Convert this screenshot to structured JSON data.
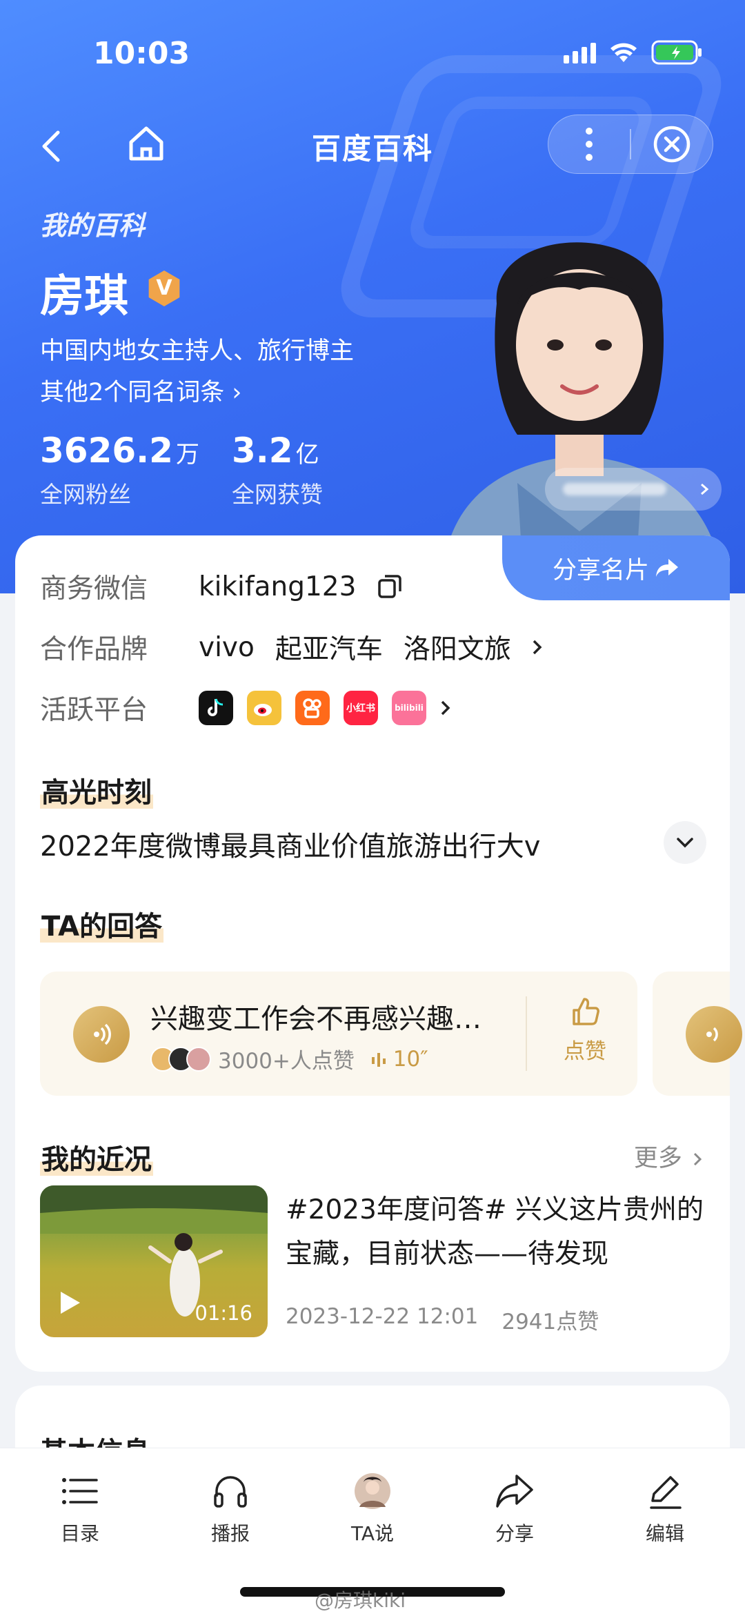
{
  "status_bar": {
    "time": "10:03"
  },
  "nav": {
    "title": "百度百科"
  },
  "hero": {
    "section_label": "我的百科",
    "name": "房琪",
    "badge": "V",
    "description": "中国内地女主持人、旅行博主",
    "same_name_link": "其他2个同名词条 ›",
    "stats": [
      {
        "value": "3626.2",
        "unit": "万",
        "label": "全网粉丝"
      },
      {
        "value": "3.2",
        "unit": "亿",
        "label": "全网获赞"
      }
    ]
  },
  "card": {
    "share_label": "分享名片",
    "rows": {
      "wechat": {
        "key": "商务微信",
        "value": "kikifang123"
      },
      "brands": {
        "key": "合作品牌",
        "values": [
          "vivo",
          "起亚汽车",
          "洛阳文旅"
        ]
      },
      "platforms": {
        "key": "活跃平台",
        "items": [
          {
            "icon": "douyin-icon",
            "color": "#111111"
          },
          {
            "icon": "weibo-icon",
            "color": "#f5c23b"
          },
          {
            "icon": "kuaishou-icon",
            "color": "#ff6a1a"
          },
          {
            "icon": "xiaohongshu-icon",
            "label": "小红书",
            "color": "#ff2442"
          },
          {
            "icon": "bilibili-icon",
            "label": "bilibili",
            "color": "#fb7299"
          }
        ]
      }
    },
    "highlight": {
      "title": "高光时刻",
      "text": "2022年度微博最具商业价值旅游出行大v"
    },
    "answers": {
      "title": "TA的回答",
      "item": {
        "question": "兴趣变工作会不再感兴趣…",
        "likes": "3000+人点赞",
        "duration": "10″",
        "like_label": "点赞"
      }
    },
    "recent": {
      "title": "我的近况",
      "more": "更多",
      "post": {
        "title": "#2023年度问答# 兴义这片贵州的宝藏，目前状态——待发现",
        "video_duration": "01:16",
        "date": "2023-12-22 12:01",
        "likes": "2941点赞"
      }
    }
  },
  "basic_info": {
    "title": "基本信息"
  },
  "tabbar": {
    "items": [
      {
        "label": "目录",
        "icon": "list-icon"
      },
      {
        "label": "播报",
        "icon": "headphones-icon"
      },
      {
        "label": "TA说",
        "icon": "avatar"
      },
      {
        "label": "分享",
        "icon": "share-icon"
      },
      {
        "label": "编辑",
        "icon": "edit-icon"
      }
    ]
  },
  "watermark": "@房琪kiki"
}
